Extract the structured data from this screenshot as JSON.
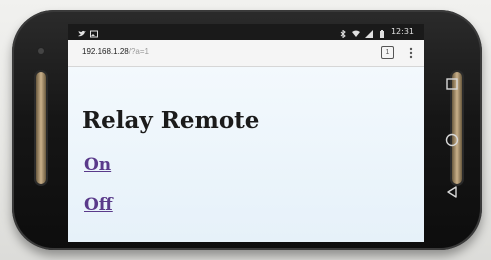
{
  "status_bar": {
    "time": "12:31",
    "left_icons": [
      "twitter-icon",
      "gallery-icon"
    ],
    "right_icons": [
      "bluetooth-icon",
      "wifi-icon",
      "signal-icon",
      "battery-icon"
    ]
  },
  "browser": {
    "url_host": "192.168.1.28",
    "url_path": "/?a=1",
    "tab_count": "1",
    "menu_icon": "overflow-menu-icon"
  },
  "page": {
    "title": "Relay Remote",
    "links": {
      "on": "On",
      "off": "Off"
    }
  },
  "nav_bar": {
    "icons": [
      "recents-icon",
      "home-icon",
      "back-icon"
    ]
  },
  "colors": {
    "page_background": "#e6f1f9",
    "link": "#5a3a8a",
    "title": "#1b1b1b",
    "phone_body": "#161616",
    "speaker_grille": "#c9b08a"
  }
}
